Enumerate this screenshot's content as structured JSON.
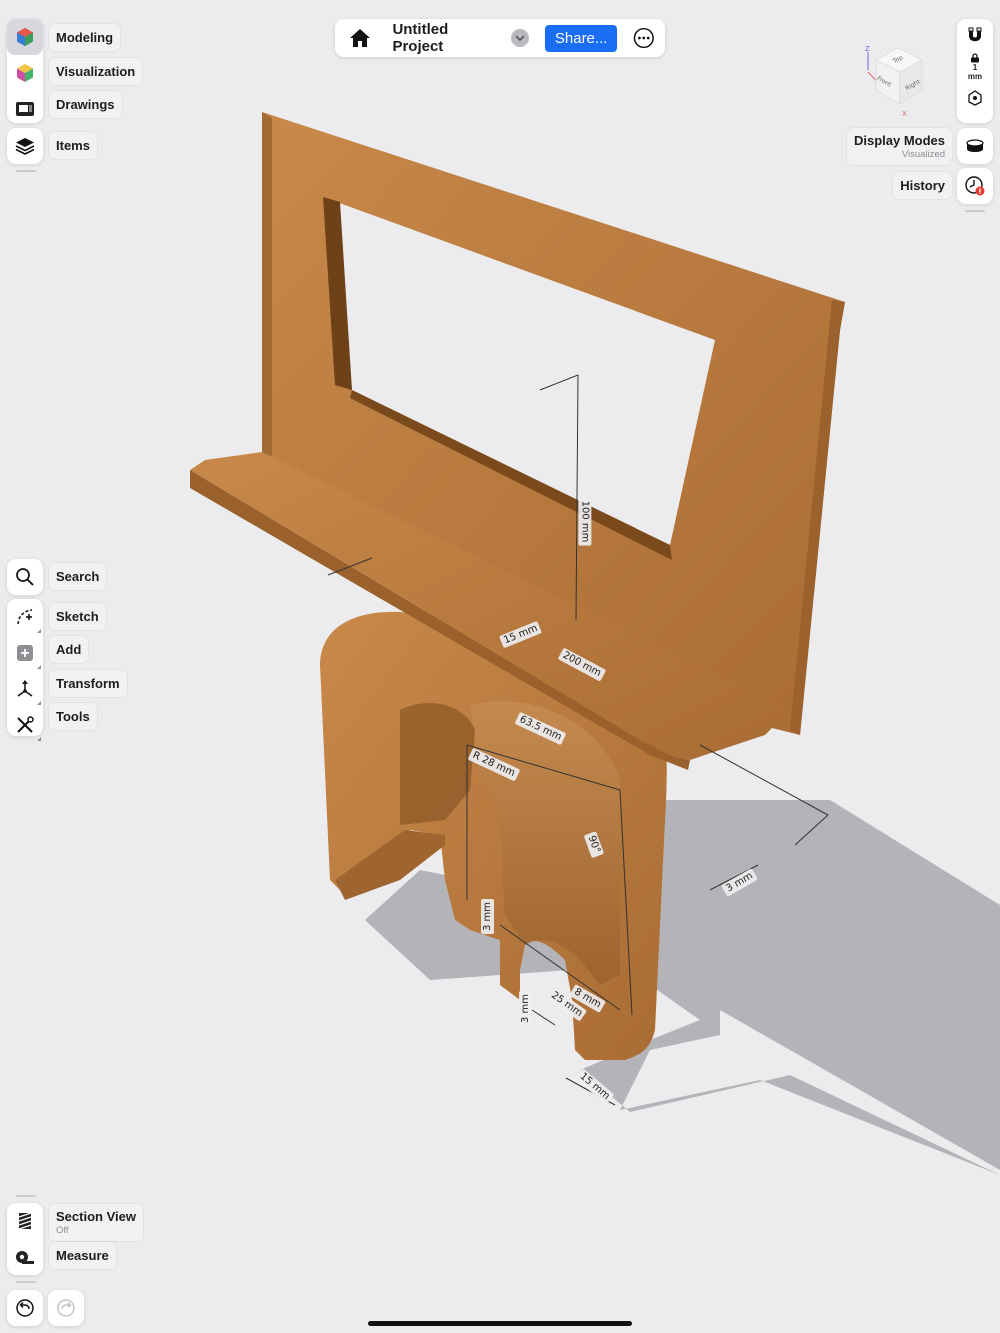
{
  "topbar": {
    "project_title": "Untitled Project",
    "share_label": "Share..."
  },
  "workspaces": [
    {
      "label": "Modeling",
      "active": true
    },
    {
      "label": "Visualization"
    },
    {
      "label": "Drawings"
    }
  ],
  "items_label": "Items",
  "tools": [
    {
      "label": "Search"
    },
    {
      "label": "Sketch"
    },
    {
      "label": "Add"
    },
    {
      "label": "Transform"
    },
    {
      "label": "Tools"
    }
  ],
  "bottom": {
    "section_view": {
      "label": "Section View",
      "status": "Off"
    },
    "measure_label": "Measure"
  },
  "right": {
    "grid": {
      "value": "1",
      "unit": "mm"
    },
    "display_modes": {
      "label": "Display Modes",
      "status": "Visualized"
    },
    "history_label": "History"
  },
  "view_cube": {
    "top": "Top",
    "front": "Front",
    "right": "Right",
    "axis_z": "Z",
    "axis_x": "X"
  },
  "dimensions": [
    {
      "text": "15 mm"
    },
    {
      "text": "200 mm"
    },
    {
      "text": "100 mm"
    },
    {
      "text": "63.5 mm"
    },
    {
      "text": "R 28 mm"
    },
    {
      "text": "90°"
    },
    {
      "text": "3 mm"
    },
    {
      "text": "3 mm"
    },
    {
      "text": "8 mm"
    },
    {
      "text": "25 mm"
    },
    {
      "text": "3 mm"
    },
    {
      "text": "15 mm"
    }
  ],
  "colors": {
    "accent": "#1a6ef5",
    "wood_light": "#c98e4e",
    "wood_dark": "#a66a31",
    "background": "#ececee"
  }
}
